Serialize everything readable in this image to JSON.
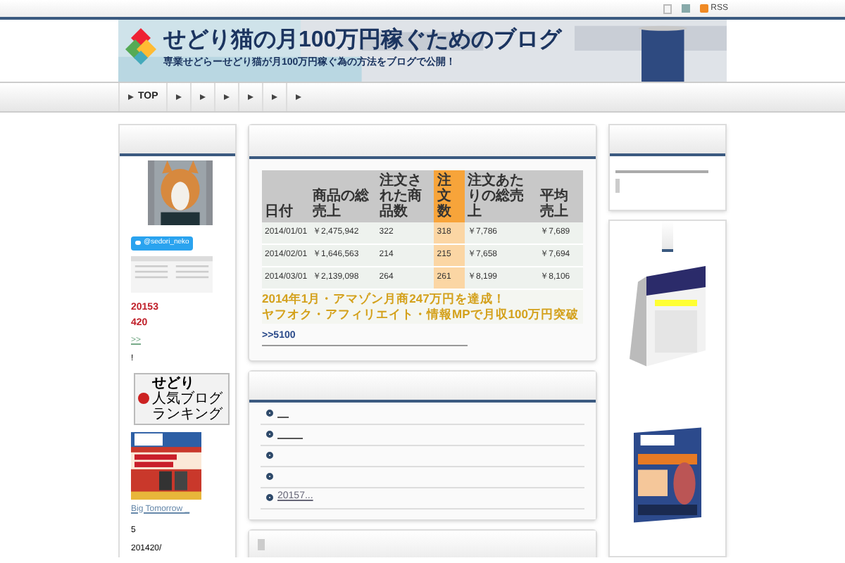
{
  "top_bar": {
    "rss": "RSS"
  },
  "header": {
    "title": "せどり猫の月100万円稼ぐためのブログ",
    "subtitle": "専業せどらーせどり猫が月100万円稼ぐ為の方法をブログで公開！"
  },
  "nav": [
    {
      "kind": "home",
      "label": "TOP"
    },
    {
      "kind": "arrow"
    },
    {
      "kind": "arrow"
    },
    {
      "kind": "arrow"
    },
    {
      "kind": "arrow"
    },
    {
      "kind": "arrow"
    },
    {
      "kind": "arrow"
    }
  ],
  "left_sidebar": {
    "twitter": "@sedori_neko",
    "stats": [
      "20153",
      "420"
    ],
    "link": ">>",
    "note": "!",
    "ranking": [
      "せどり",
      "人気ブログランキング"
    ],
    "book_link": "Big Tomorrow _",
    "count": "5",
    "date": "201420/"
  },
  "sales": {
    "columns": [
      "日付",
      "商品の総売上",
      "注文された商品数",
      "注文数",
      "注文あたりの総売上",
      "平均売上"
    ],
    "rows": [
      [
        "2014/01/01",
        "￥2,475,942",
        "322",
        "318",
        "￥7,786",
        "￥7,689"
      ],
      [
        "2014/02/01",
        "￥1,646,563",
        "214",
        "215",
        "￥7,658",
        "￥7,694"
      ],
      [
        "2014/03/01",
        "￥2,139,098",
        "264",
        "261",
        "￥8,199",
        "￥8,106"
      ]
    ],
    "headline": [
      "2014年1月・アマゾン月商247万円を達成！",
      "ヤフオク・アフィリエイト・情報MPで月収100万円突破"
    ],
    "link": ">>5100"
  },
  "articles": [
    {
      "kind": "blank"
    },
    {
      "kind": "blank-long"
    },
    {
      "kind": "empty"
    },
    {
      "kind": "empty"
    },
    {
      "kind": "text",
      "text": "20157..."
    }
  ]
}
